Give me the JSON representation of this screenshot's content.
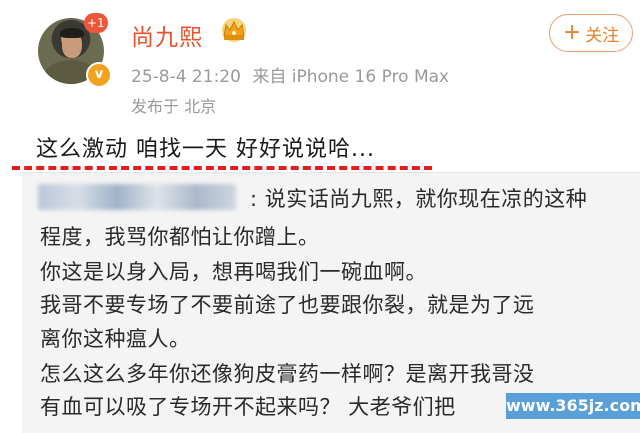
{
  "header": {
    "username": "尚九熙",
    "notification_count": "+1",
    "verify_badge": "v",
    "post_date": "25-8-4 21:20",
    "post_source": "来自 iPhone 16 Pro Max",
    "post_location": "发布于 北京",
    "follow_label": "关注",
    "follow_plus": "+",
    "follow_color": "#e8832b",
    "name_color": "#e8532b"
  },
  "post": {
    "text": "这么激动 咱找一天 好好说说哈..."
  },
  "comment": {
    "lines": [
      ": 说实话尚九熙，就你现在凉的这种",
      "程度，我骂你都怕让你蹭上。",
      "你这是以身入局，想再喝我们一碗血啊。",
      "我哥不要专场了不要前途了也要跟你裂，就是为了远",
      "离你这种瘟人。",
      "怎么这么多年你还像狗皮膏药一样啊？是离开我哥没",
      "有血可以吸了专场开不起来吗？ 大老爷们把"
    ]
  },
  "watermark": {
    "text": "www.365jz.com"
  }
}
